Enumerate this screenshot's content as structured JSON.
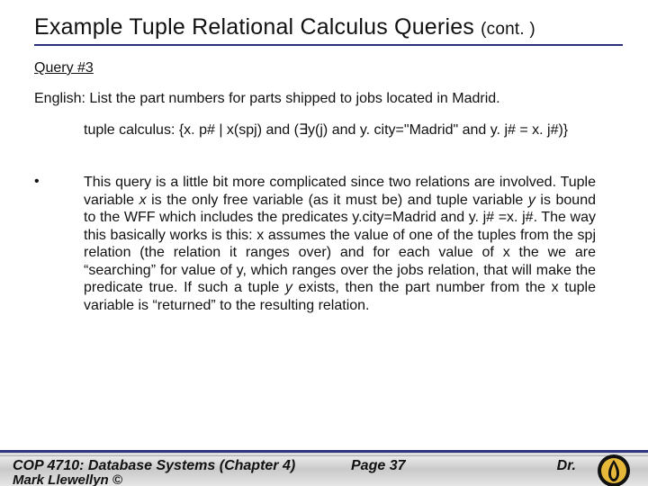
{
  "title_main": "Example Tuple Relational Calculus Queries",
  "title_cont": "(cont. )",
  "query_label": "Query #3",
  "english": "English:  List the part numbers for parts shipped to jobs located in Madrid.",
  "calculus": "tuple calculus:  {x. p# | x(spj) and (∃y(j) and y. city=\"Madrid\" and y. j# = x. j#)}",
  "bullet_mark": "•",
  "explanation_html": "This query is a little bit more complicated since two relations are involved.  Tuple variable <em>x</em> is the only free variable (as it must be) and tuple variable <em>y</em> is bound to the WFF which includes the predicates y.city=Madrid and y. j# =x. j#.  The way this basically works is this:  x assumes the value of one of the tuples from the spj relation (the relation it ranges over) and for each value of x the we are “searching” for value of y, which ranges over the jobs relation, that will make the predicate true.  If such a tuple <em>y</em> exists, then the part number from the x tuple variable is “returned” to the resulting relation.",
  "footer": {
    "course": "COP 4710: Database Systems  (Chapter 4)",
    "page": "Page 37",
    "dr": "Dr.",
    "frag": "Mark Llewellyn ©"
  }
}
